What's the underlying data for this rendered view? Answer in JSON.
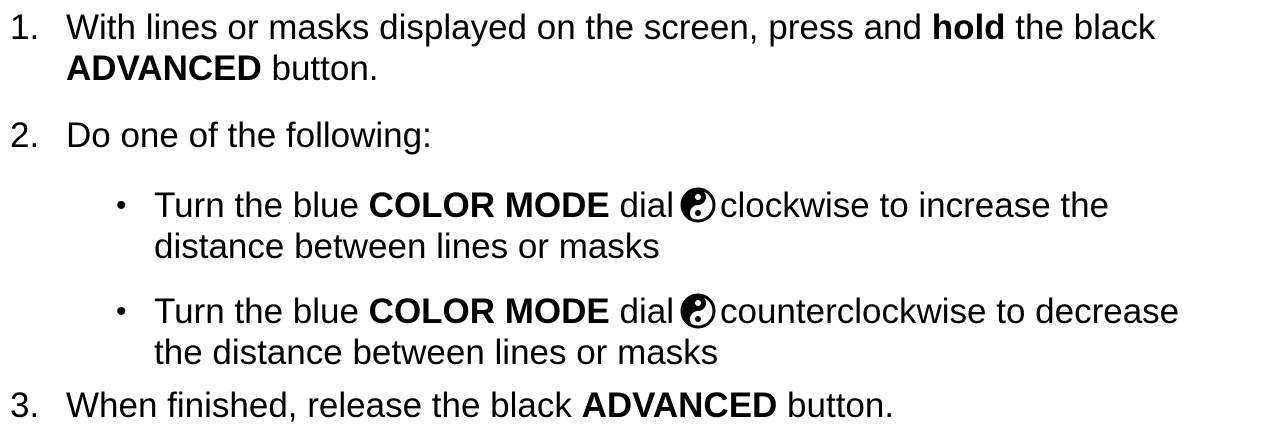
{
  "steps": [
    {
      "number": "1.",
      "line1": {
        "t1": "With lines or masks displayed on the screen, press and ",
        "b1": "hold",
        "t2": " the black"
      },
      "line2": {
        "b1": "ADVANCED",
        "t1": " button."
      }
    },
    {
      "number": "2.",
      "text": "Do one of the following:",
      "bullets": [
        {
          "symbol": "•",
          "t1": "Turn the blue ",
          "b1": "COLOR MODE",
          "t2": " dial",
          "icon": "color-mode-dial-icon",
          "t3": "clockwise to increase the",
          "cont": "distance between lines or masks"
        },
        {
          "symbol": "•",
          "t1": "Turn the blue ",
          "b1": "COLOR MODE",
          "t2": " dial",
          "icon": "color-mode-dial-icon",
          "t3": "counterclockwise to decrease",
          "cont": "the distance between lines or masks"
        }
      ]
    },
    {
      "number": "3.",
      "t1": "When finished, release the black ",
      "b1": "ADVANCED",
      "t2": " button."
    }
  ]
}
